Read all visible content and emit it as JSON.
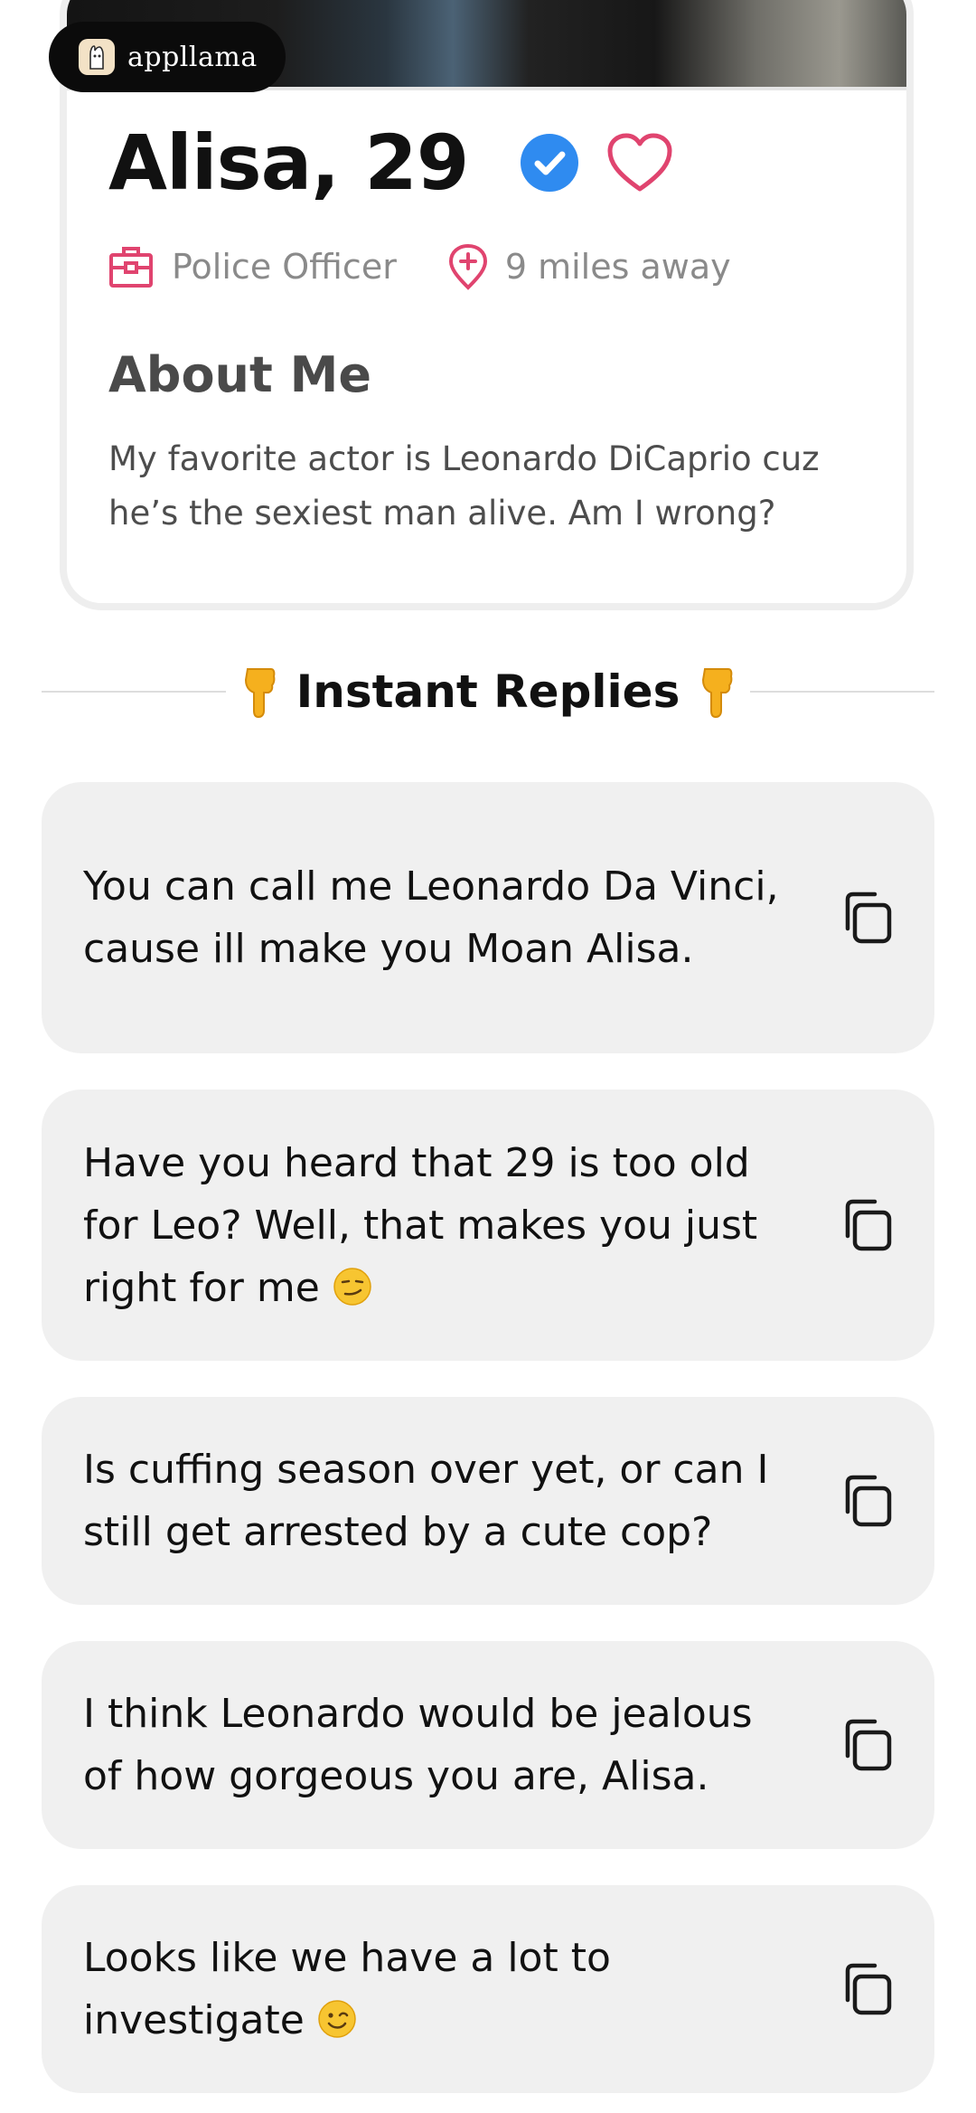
{
  "app": {
    "logo_text": "appllama"
  },
  "profile": {
    "name_age": "Alisa, 29",
    "job": "Police Officer",
    "distance": "9 miles away",
    "about_title": "About Me",
    "about_text": "My favorite actor is Leonardo DiCaprio cuz he’s the sexiest man alive. Am I wrong?"
  },
  "section": {
    "title": "Instant Replies",
    "icon": "pointing-down-hand-emoji"
  },
  "replies": [
    {
      "text": "You can call me Leonardo Da Vinci, cause ill make you Moan Alisa.",
      "emoji": ""
    },
    {
      "text": "Have you heard that 29 is too old for Leo? Well, that makes you just right for me",
      "emoji": "smirking-face"
    },
    {
      "text": "Is cuffing season over yet, or can I still get arrested by a cute cop?",
      "emoji": ""
    },
    {
      "text": "I think Leonardo would be jealous of how gorgeous you are, Alisa.",
      "emoji": ""
    },
    {
      "text": "Looks like we have a lot to investigate",
      "emoji": "winking-face"
    }
  ],
  "colors": {
    "accent_pink": "#e0446f",
    "verified_blue": "#2f8bf0",
    "card_gray": "#f0f0f0"
  }
}
